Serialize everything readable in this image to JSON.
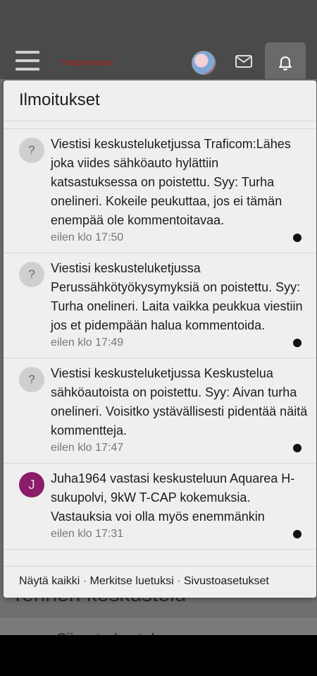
{
  "header": {
    "logo_text": "Sampopumpat",
    "menu_icon": "hamburger-icon",
    "mail_icon": "mail-icon",
    "bell_icon": "bell-icon"
  },
  "background": {
    "heading": "Tehnen keskustelu",
    "row_text": "Siirry tarkasteluun"
  },
  "popup": {
    "title": "Ilmoitukset",
    "notifications": [
      {
        "badge": "?",
        "message": "Viestisi keskusteluketjussa Traficom:Lähes joka viides sähköauto hylättiin katsastuksessa on poistettu. Syy: Turha onelineri. Kokeile peukuttaa, jos ei tämän enempää ole kommentoitavaa.",
        "time": "eilen klo 17:50",
        "unread": true
      },
      {
        "badge": "?",
        "message": "Viestisi keskusteluketjussa Perussähkötyökysymyksiä on poistettu. Syy: Turha onelineri. Laita vaikka peukkua viestiin jos et pidempään halua kommentoida.",
        "time": "eilen klo 17:49",
        "unread": true
      },
      {
        "badge": "?",
        "message": "Viestisi keskusteluketjussa Keskustelua sähköautoista on poistettu. Syy: Aivan turha onelineri. Voisitko ystävällisesti pidentää näitä kommentteja.",
        "time": "eilen klo 17:47",
        "unread": true
      },
      {
        "badge": "J",
        "message": "Juha1964 vastasi keskusteluun Aquarea H-sukupolvi, 9kW T-CAP kokemuksia. Vastauksia voi olla myös enemmänkin",
        "time": "eilen klo 17:31",
        "unread": true
      }
    ],
    "footer": {
      "show_all": "Näytä kaikki",
      "mark_read": "Merkitse luetuksi",
      "site_settings": "Sivustoasetukset",
      "separator": "·"
    }
  }
}
